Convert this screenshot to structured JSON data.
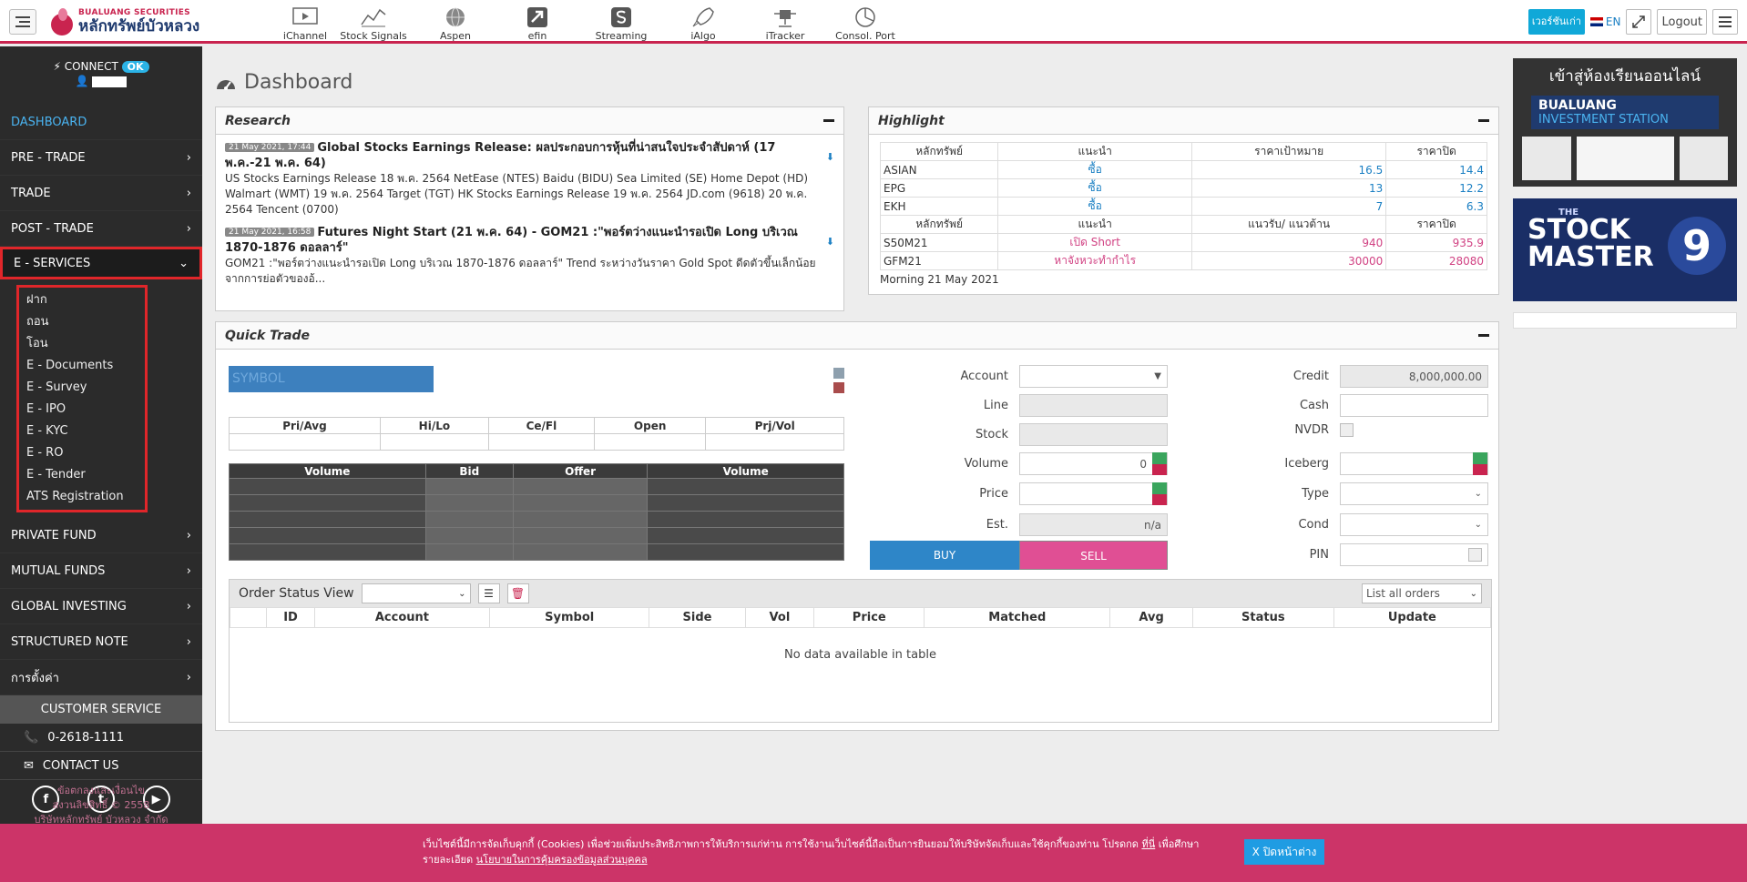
{
  "header": {
    "logo_en": "BUALUANG SECURITIES",
    "logo_th": "หลักทรัพย์บัวหลวง",
    "apps": [
      "iChannel",
      "Stock Signals",
      "Aspen",
      "efin",
      "Streaming",
      "iAlgo",
      "iTracker",
      "Consol. Port"
    ],
    "old_version_label": "เวอร์ชันเก่า",
    "lang": "EN",
    "logout": "Logout"
  },
  "sidebar": {
    "connect": "CONNECT",
    "status": "OK",
    "nav": [
      {
        "label": "DASHBOARD"
      },
      {
        "label": "PRE - TRADE"
      },
      {
        "label": "TRADE"
      },
      {
        "label": "POST - TRADE"
      },
      {
        "label": "E - SERVICES"
      }
    ],
    "eservices": [
      "ฝาก",
      "ถอน",
      "โอน",
      "E - Documents",
      "E - Survey",
      "E - IPO",
      "E - KYC",
      "E - RO",
      "E - Tender",
      "ATS Registration"
    ],
    "nav2": [
      {
        "label": "PRIVATE FUND"
      },
      {
        "label": "MUTUAL FUNDS"
      },
      {
        "label": "GLOBAL INVESTING"
      },
      {
        "label": "STRUCTURED NOTE"
      },
      {
        "label": "การตั้งค่า"
      }
    ],
    "customer_service": "CUSTOMER SERVICE",
    "phone": "0-2618-1111",
    "contact": "CONTACT US",
    "copyright": [
      "ข้อตกลงและเงื่อนไข",
      "สงวนลิขสิทธิ์ © 2558",
      "บริษัทหลักทรัพย์ บัวหลวง จำกัด"
    ]
  },
  "page": {
    "title": "Dashboard"
  },
  "research": {
    "title": "Research",
    "items": [
      {
        "date": "21 May 2021, 17:44",
        "title": "Global Stocks Earnings Release: ผลประกอบการหุ้นที่น่าสนใจประจำสัปดาห์ (17 พ.ค.-21 พ.ค. 64)",
        "body": "US Stocks Earnings Release 18 พ.ค. 2564 NetEase (NTES) Baidu (BIDU) Sea Limited (SE) Home Depot (HD) Walmart (WMT) 19 พ.ค. 2564 Target (TGT) HK Stocks Earnings Release 19 พ.ค. 2564 JD.com (9618) 20 พ.ค. 2564 Tencent (0700)"
      },
      {
        "date": "21 May 2021, 16:58",
        "title": "Futures Night Start (21 พ.ค. 64) - GOM21 :\"พอร์ตว่างแนะนำรอเปิด Long บริเวณ 1870-1876 ดอลลาร์\"",
        "body": "GOM21 :\"พอร์ตว่างแนะนำรอเปิด Long บริเวณ 1870-1876 ดอลลาร์\" Trend ระหว่างวันราคา Gold Spot ดีดตัวขึ้นเล็กน้อยจากการย่อตัวของอ้..."
      }
    ]
  },
  "highlight": {
    "title": "Highlight",
    "head1": [
      "หลักทรัพย์",
      "แนะนำ",
      "ราคาเป้าหมาย",
      "ราคาปิด"
    ],
    "rows1": [
      [
        "ASIAN",
        "ซื้อ",
        "16.5",
        "14.4"
      ],
      [
        "EPG",
        "ซื้อ",
        "13",
        "12.2"
      ],
      [
        "EKH",
        "ซื้อ",
        "7",
        "6.3"
      ]
    ],
    "head2": [
      "หลักทรัพย์",
      "แนะนำ",
      "แนวรับ/ แนวต้าน",
      "ราคาปิด"
    ],
    "rows2": [
      [
        "S50M21",
        "เปิด Short",
        "940",
        "935.9"
      ],
      [
        "GFM21",
        "หาจังหวะทำกำไร",
        "30000",
        "28080"
      ]
    ],
    "footer": "Morning 21 May 2021"
  },
  "quick_trade": {
    "title": "Quick Trade",
    "symbol_placeholder": "SYMBOL",
    "info_headers": [
      "Pri/Avg",
      "Hi/Lo",
      "Ce/Fl",
      "Open",
      "Prj/Vol"
    ],
    "depth_headers": [
      "Volume",
      "Bid",
      "Offer",
      "Volume"
    ],
    "labels": {
      "account": "Account",
      "line": "Line",
      "stock": "Stock",
      "volume": "Volume",
      "price": "Price",
      "est": "Est.",
      "credit": "Credit",
      "cash": "Cash",
      "nvdr": "NVDR",
      "iceberg": "Iceberg",
      "type": "Type",
      "cond": "Cond",
      "pin": "PIN"
    },
    "volume_value": "0",
    "est_value": "n/a",
    "credit_value": "8,000,000.00",
    "buy": "BUY",
    "sell": "SELL",
    "order_status": {
      "title": "Order Status View",
      "filter": "List all orders",
      "columns": [
        "ID",
        "Account",
        "Symbol",
        "Side",
        "Vol",
        "Price",
        "Matched",
        "Avg",
        "Status",
        "Update"
      ],
      "empty": "No data available in table"
    }
  },
  "ads": {
    "ad1_line1": "เข้าสู่ห้องเรียนออนไลน์",
    "ad1_line2": "BUALUANG",
    "ad1_line3": "INVESTMENT STATION",
    "ad2_small": "THE",
    "ad2_line1": "STOCK",
    "ad2_line2": "MASTER",
    "ad2_num": "9"
  },
  "cookie": {
    "text": "เว็บไซต์นี้มีการจัดเก็บคุกกี้ (Cookies) เพื่อช่วยเพิ่มประสิทธิภาพการให้บริการแก่ท่าน การใช้งานเว็บไซต์นี้ถือเป็นการยินยอมให้บริษัทจัดเก็บและใช้คุกกี้ของท่าน โปรดกด",
    "link1": "ที่นี่",
    "text2": "เพื่อศึกษารายละเอียด",
    "link2": "นโยบายในการคุ้มครองข้อมูลส่วนบุคคล",
    "close": "X ปิดหน้าต่าง"
  },
  "colors": {
    "brand": "#c9244f",
    "sidebar": "#2b2b2b",
    "accent": "#10a8d8",
    "buy": "#2e86c8",
    "sell": "#e04f94"
  }
}
